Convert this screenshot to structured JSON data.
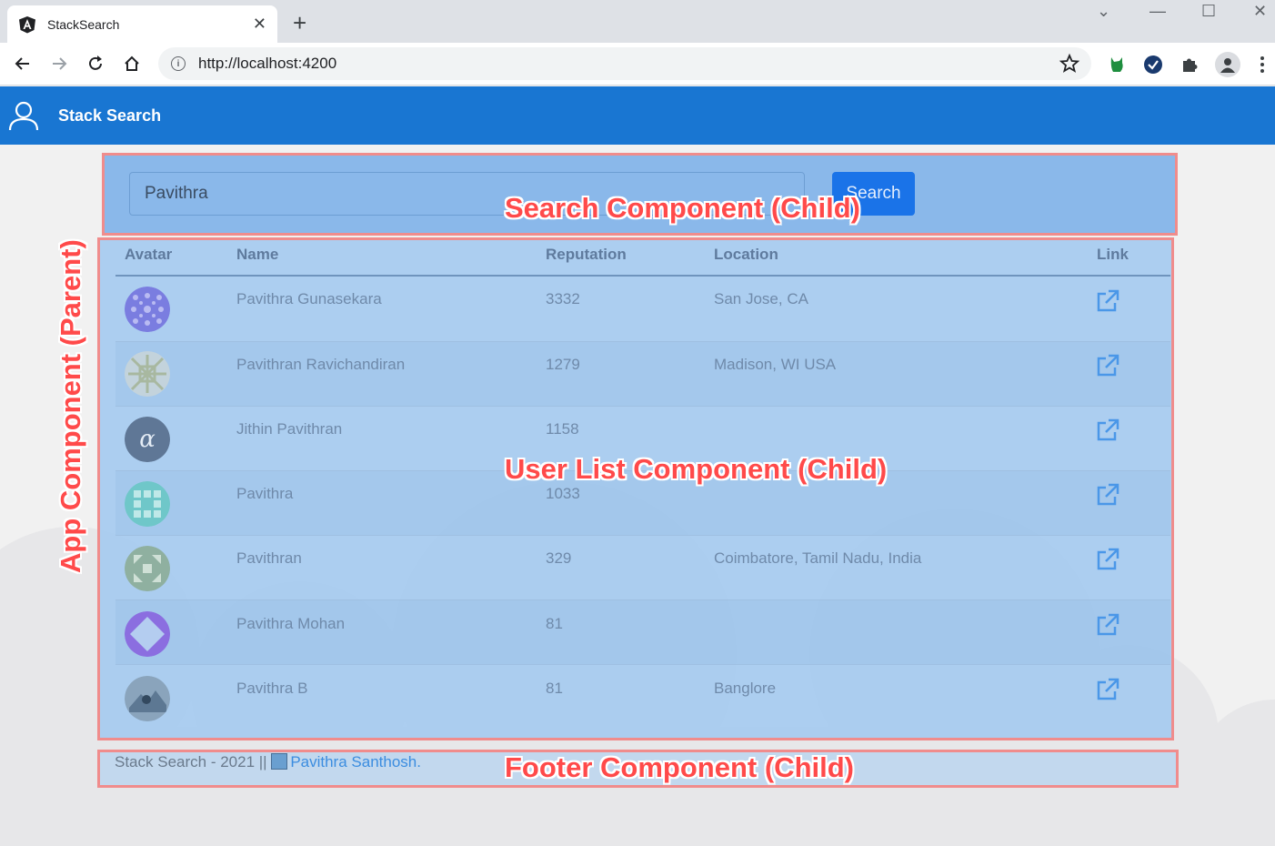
{
  "browser": {
    "tab_title": "StackSearch",
    "url": "http://localhost:4200"
  },
  "app": {
    "brand": "Stack Search"
  },
  "search": {
    "value": "Pavithra",
    "button_label": "Search"
  },
  "table": {
    "headers": [
      "Avatar",
      "Name",
      "Reputation",
      "Location",
      "Link"
    ],
    "rows": [
      {
        "name": "Pavithra Gunasekara",
        "reputation": "3332",
        "location": "San Jose, CA"
      },
      {
        "name": "Pavithran Ravichandiran",
        "reputation": "1279",
        "location": "Madison, WI USA"
      },
      {
        "name": "Jithin Pavithran",
        "reputation": "1158",
        "location": ""
      },
      {
        "name": "Pavithra",
        "reputation": "1033",
        "location": ""
      },
      {
        "name": "Pavithran",
        "reputation": "329",
        "location": "Coimbatore, Tamil Nadu, India"
      },
      {
        "name": "Pavithra Mohan",
        "reputation": "81",
        "location": ""
      },
      {
        "name": "Pavithra B",
        "reputation": "81",
        "location": "Banglore"
      }
    ]
  },
  "footer": {
    "text": "Stack Search - 2021 || ",
    "link": "Pavithra Santhosh",
    "suffix": "."
  },
  "annotations": {
    "search": "Search Component (Child)",
    "userlist": "User List Component (Child)",
    "footer": "Footer Component (Child)",
    "app": "App Component (Parent)"
  },
  "colors": {
    "appbar": "#1976d2",
    "search_button": "#1a73e8",
    "annotation": "#ff4a4a"
  }
}
